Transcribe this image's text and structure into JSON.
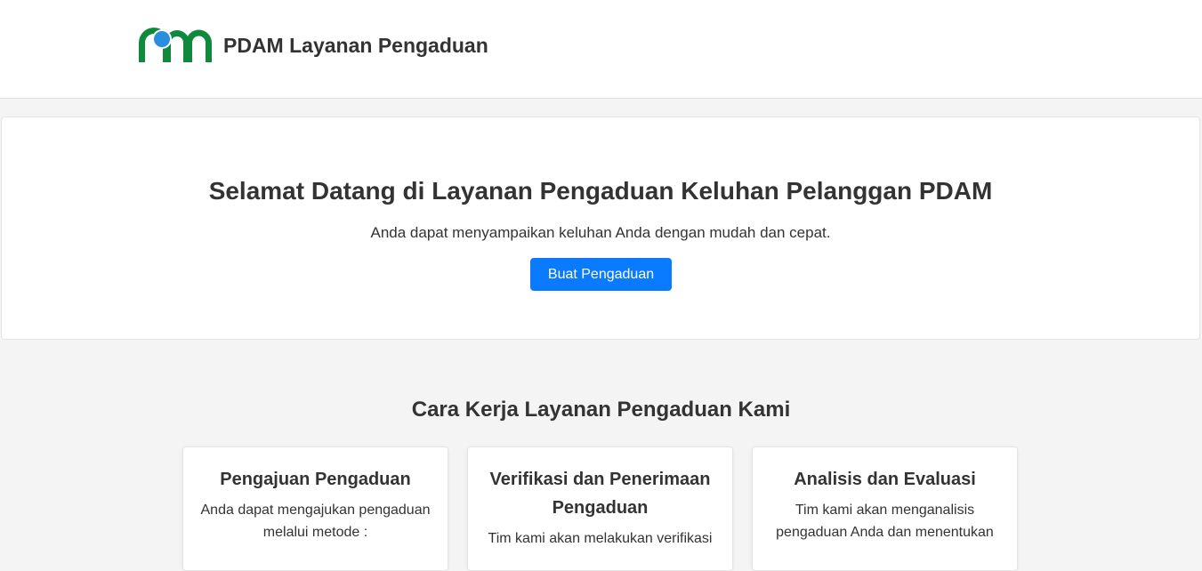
{
  "header": {
    "title": "PDAM Layanan Pengaduan",
    "logo_icon": "pdam-logo-icon",
    "logo_colors": {
      "green": "#0f8a3c",
      "blue": "#2a8ee0"
    }
  },
  "hero": {
    "title": "Selamat Datang di Layanan Pengaduan Keluhan Pelanggan PDAM",
    "subtitle": "Anda dapat menyampaikan keluhan Anda dengan mudah dan cepat.",
    "button_label": "Buat Pengaduan",
    "button_color": "#0a7bff"
  },
  "steps": {
    "section_title": "Cara Kerja Layanan Pengaduan Kami",
    "cards": [
      {
        "title": "Pengajuan Pengaduan",
        "text": "Anda dapat mengajukan pengaduan melalui metode :"
      },
      {
        "title": "Verifikasi dan Penerimaan Pengaduan",
        "text": "Tim kami akan melakukan verifikasi"
      },
      {
        "title": "Analisis dan Evaluasi",
        "text": "Tim kami akan menganalisis pengaduan Anda dan menentukan"
      }
    ]
  }
}
